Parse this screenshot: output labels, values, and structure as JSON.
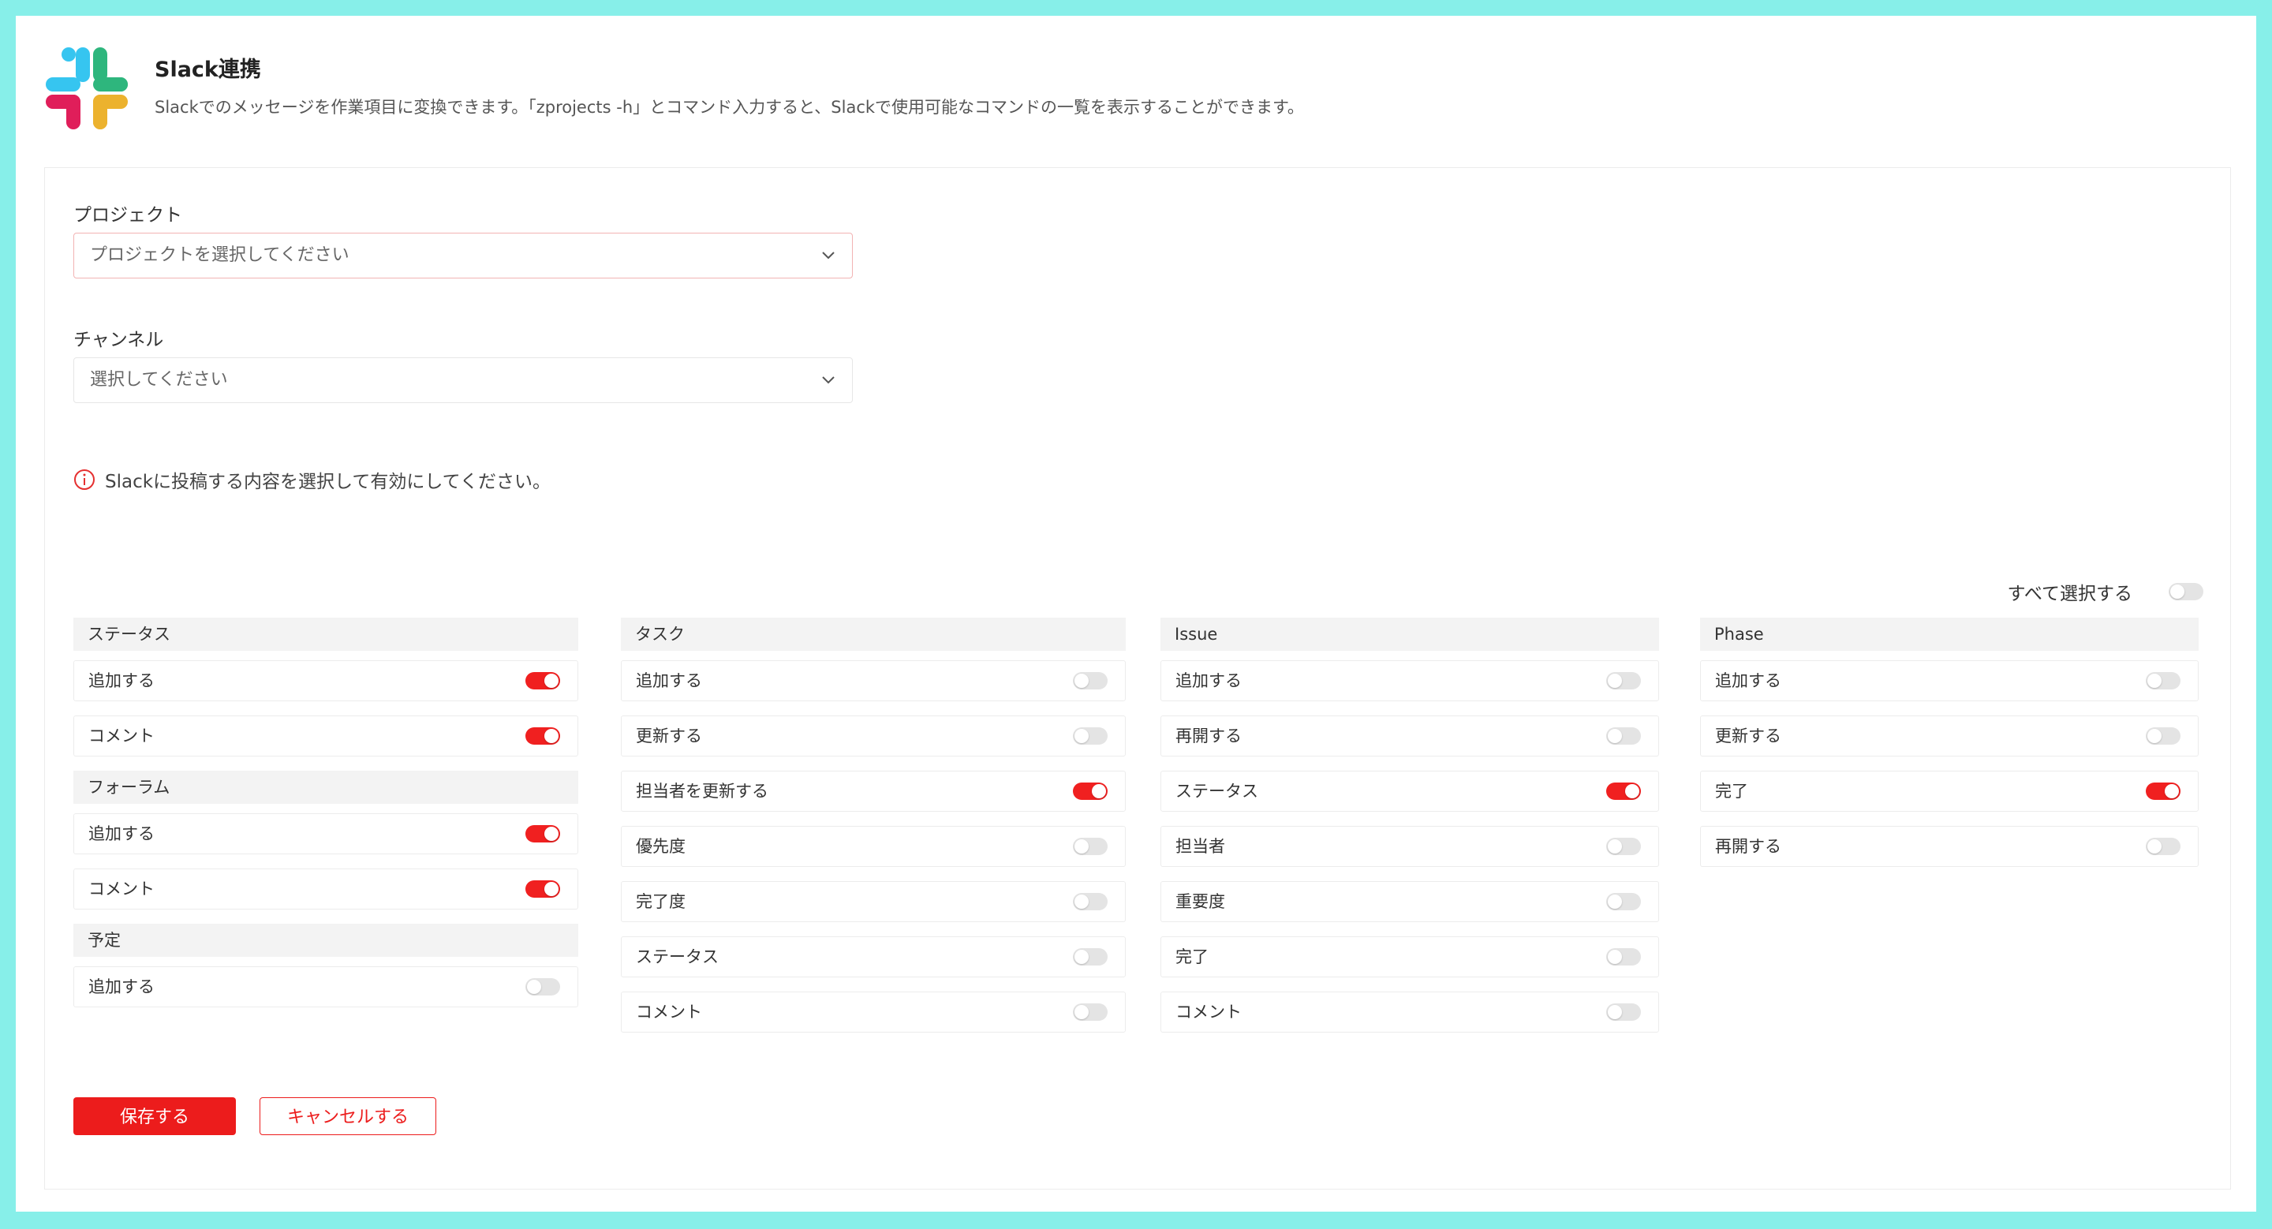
{
  "header": {
    "title": "Slack連携",
    "description": "Slackでのメッセージを作業項目に変換できます。「zprojects -h」とコマンド入力すると、Slackで使用可能なコマンドの一覧を表示することができます。"
  },
  "form": {
    "project_label": "プロジェクト",
    "project_placeholder": "プロジェクトを選択してください",
    "channel_label": "チャンネル",
    "channel_placeholder": "選択してください",
    "info_text": "Slackに投稿する内容を選択して有効にしてください。"
  },
  "select_all": {
    "label": "すべて選択する",
    "on": false
  },
  "columns": [
    {
      "sections": [
        {
          "title": "ステータス",
          "rows": [
            {
              "label": "追加する",
              "on": true
            },
            {
              "label": "コメント",
              "on": true
            }
          ]
        },
        {
          "title": "フォーラム",
          "rows": [
            {
              "label": "追加する",
              "on": true
            },
            {
              "label": "コメント",
              "on": true
            }
          ]
        },
        {
          "title": "予定",
          "rows": [
            {
              "label": "追加する",
              "on": false
            }
          ]
        }
      ]
    },
    {
      "sections": [
        {
          "title": "タスク",
          "rows": [
            {
              "label": "追加する",
              "on": false
            },
            {
              "label": "更新する",
              "on": false
            },
            {
              "label": "担当者を更新する",
              "on": true
            },
            {
              "label": "優先度",
              "on": false
            },
            {
              "label": "完了度",
              "on": false
            },
            {
              "label": "ステータス",
              "on": false
            },
            {
              "label": "コメント",
              "on": false
            }
          ]
        }
      ]
    },
    {
      "sections": [
        {
          "title": "Issue",
          "rows": [
            {
              "label": "追加する",
              "on": false
            },
            {
              "label": "再開する",
              "on": false
            },
            {
              "label": "ステータス",
              "on": true
            },
            {
              "label": "担当者",
              "on": false
            },
            {
              "label": "重要度",
              "on": false
            },
            {
              "label": "完了",
              "on": false
            },
            {
              "label": "コメント",
              "on": false
            }
          ]
        }
      ]
    },
    {
      "sections": [
        {
          "title": "Phase",
          "rows": [
            {
              "label": "追加する",
              "on": false
            },
            {
              "label": "更新する",
              "on": false
            },
            {
              "label": "完了",
              "on": true
            },
            {
              "label": "再開する",
              "on": false
            }
          ]
        }
      ]
    }
  ],
  "buttons": {
    "save": "保存する",
    "cancel": "キャンセルする"
  },
  "colors": {
    "accent": "#ec1c1c",
    "background": "#87efe9"
  }
}
